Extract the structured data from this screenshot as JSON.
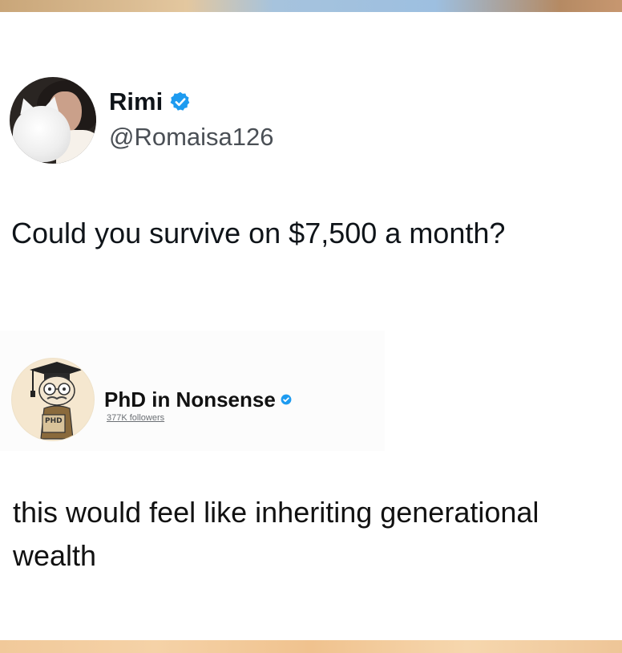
{
  "tweet": {
    "author": {
      "display_name": "Rimi",
      "handle": "@Romaisa126",
      "verified": true,
      "avatar_icon": "profile-photo-woman-with-white-cat"
    },
    "text": "Could you survive on $7,500 a month?"
  },
  "reply": {
    "author": {
      "display_name": "PhD in Nonsense",
      "followers": "377K followers",
      "verified": true,
      "avatar_icon": "cartoon-graduate-with-phd-sign",
      "avatar_sign_text": "PHD"
    },
    "text": "this would feel like inheriting generational wealth"
  },
  "colors": {
    "verified_blue": "#1d9bf0",
    "text_primary": "#0f1419",
    "text_secondary": "#4a4f55"
  }
}
